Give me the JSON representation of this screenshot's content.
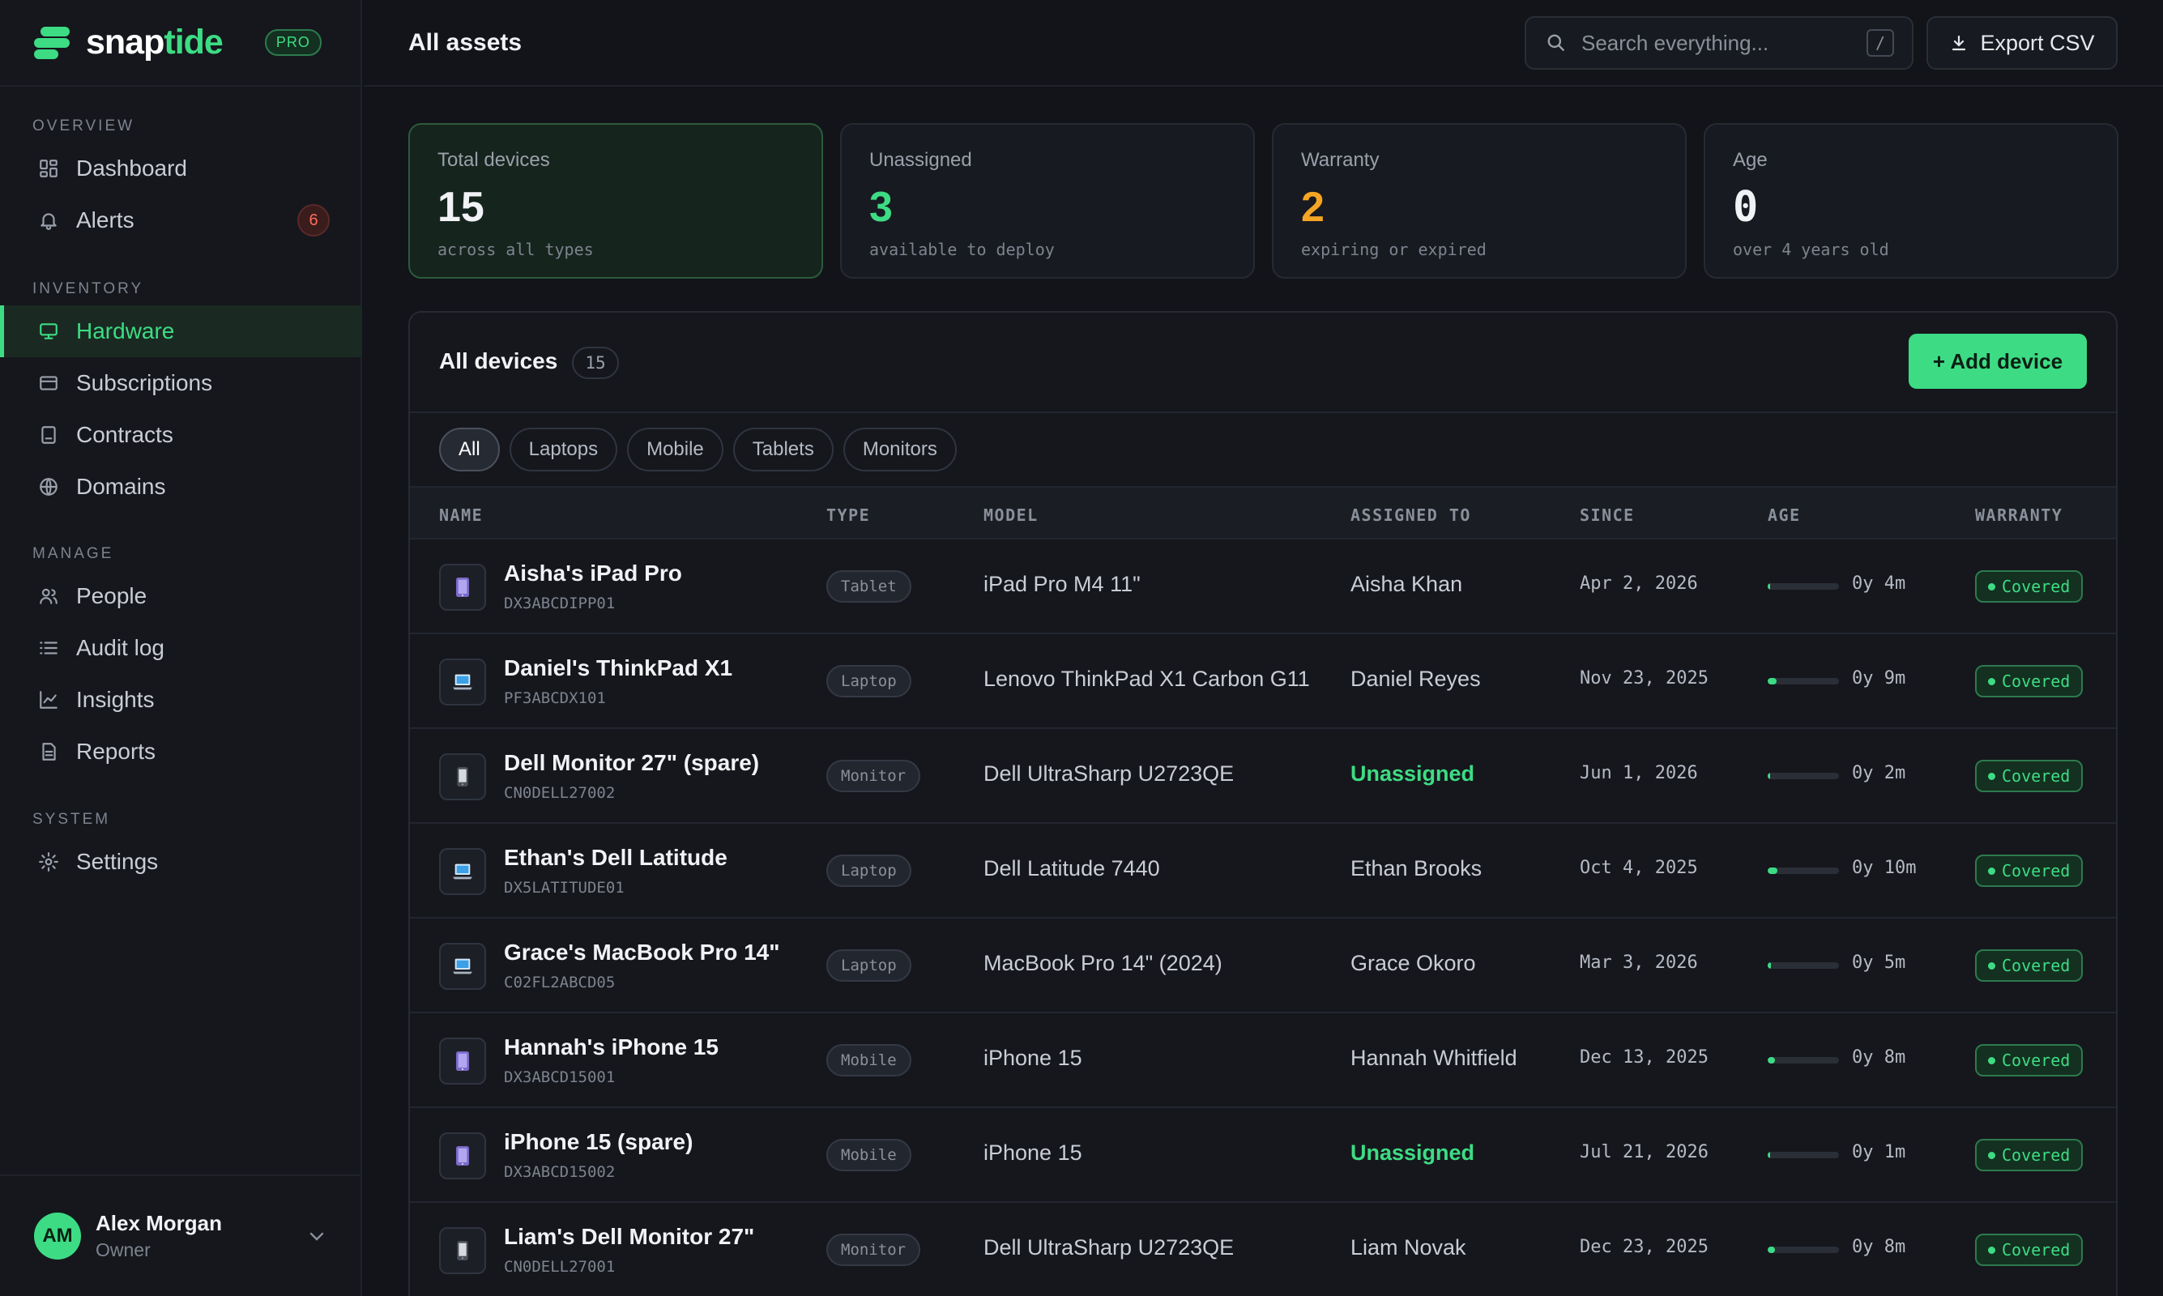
{
  "app": {
    "name_prefix": "snap",
    "name_suffix": "tide",
    "plan_badge": "PRO"
  },
  "sidebar": {
    "sections": [
      {
        "heading": "OVERVIEW",
        "items": [
          {
            "label": "Dashboard",
            "icon": "dashboard-icon"
          },
          {
            "label": "Alerts",
            "icon": "bell-icon",
            "badge": "6"
          }
        ]
      },
      {
        "heading": "INVENTORY",
        "items": [
          {
            "label": "Hardware",
            "icon": "monitor-icon",
            "active": true
          },
          {
            "label": "Subscriptions",
            "icon": "card-icon"
          },
          {
            "label": "Contracts",
            "icon": "document-icon"
          },
          {
            "label": "Domains",
            "icon": "globe-icon"
          }
        ]
      },
      {
        "heading": "MANAGE",
        "items": [
          {
            "label": "People",
            "icon": "people-icon"
          },
          {
            "label": "Audit log",
            "icon": "list-icon"
          },
          {
            "label": "Insights",
            "icon": "chart-icon"
          },
          {
            "label": "Reports",
            "icon": "report-icon"
          }
        ]
      },
      {
        "heading": "SYSTEM",
        "items": [
          {
            "label": "Settings",
            "icon": "gear-icon"
          }
        ]
      }
    ],
    "user": {
      "initials": "AM",
      "name": "Alex Morgan",
      "role": "Owner"
    }
  },
  "header": {
    "title": "All assets",
    "search_placeholder": "Search everything...",
    "search_shortcut": "/",
    "export_label": "Export CSV"
  },
  "stats": [
    {
      "label": "Total devices",
      "value": "15",
      "sub": "across all types",
      "color": "#f1f2f5"
    },
    {
      "label": "Unassigned",
      "value": "3",
      "sub": "available to deploy",
      "color": "#3ddc84"
    },
    {
      "label": "Warranty",
      "value": "2",
      "sub": "expiring or expired",
      "color": "#f5a524"
    },
    {
      "label": "Age",
      "value": "0",
      "sub": "over 4 years old",
      "color": "#f1f2f5"
    }
  ],
  "devices_panel": {
    "title": "All devices",
    "count": "15",
    "add_label": "+ Add device",
    "filters": [
      "All",
      "Laptops",
      "Mobile",
      "Tablets",
      "Monitors"
    ],
    "active_filter": "All",
    "columns": [
      "NAME",
      "TYPE",
      "MODEL",
      "ASSIGNED TO",
      "SINCE",
      "AGE",
      "WARRANTY"
    ],
    "rows": [
      {
        "name": "Aisha's iPad Pro",
        "serial": "DX3ABCDIPP01",
        "type": "Tablet",
        "icon": "tablet-icon",
        "model": "iPad Pro M4 11\"",
        "assigned": "Aisha Khan",
        "unassigned": false,
        "since": "Apr 2, 2026",
        "age_fraction": 0.03,
        "age": "0y 4m",
        "warranty": "Covered"
      },
      {
        "name": "Daniel's ThinkPad X1",
        "serial": "PF3ABCDX101",
        "type": "Laptop",
        "icon": "laptop-icon",
        "model": "Lenovo ThinkPad X1 Carbon G11",
        "assigned": "Daniel Reyes",
        "unassigned": false,
        "since": "Nov 23, 2025",
        "age_fraction": 0.12,
        "age": "0y 9m",
        "warranty": "Covered"
      },
      {
        "name": "Dell Monitor 27\" (spare)",
        "serial": "CN0DELL27002",
        "type": "Monitor",
        "icon": "monitor-device-icon",
        "model": "Dell UltraSharp U2723QE",
        "assigned": "Unassigned",
        "unassigned": true,
        "since": "Jun 1, 2026",
        "age_fraction": 0.02,
        "age": "0y 2m",
        "warranty": "Covered"
      },
      {
        "name": "Ethan's Dell Latitude",
        "serial": "DX5LATITUDE01",
        "type": "Laptop",
        "icon": "laptop-icon",
        "model": "Dell Latitude 7440",
        "assigned": "Ethan Brooks",
        "unassigned": false,
        "since": "Oct 4, 2025",
        "age_fraction": 0.14,
        "age": "0y 10m",
        "warranty": "Covered"
      },
      {
        "name": "Grace's MacBook Pro 14\"",
        "serial": "C02FL2ABCD05",
        "type": "Laptop",
        "icon": "laptop-icon",
        "model": "MacBook Pro 14\" (2024)",
        "assigned": "Grace Okoro",
        "unassigned": false,
        "since": "Mar 3, 2026",
        "age_fraction": 0.05,
        "age": "0y 5m",
        "warranty": "Covered"
      },
      {
        "name": "Hannah's iPhone 15",
        "serial": "DX3ABCD15001",
        "type": "Mobile",
        "icon": "phone-icon",
        "model": "iPhone 15",
        "assigned": "Hannah Whitfield",
        "unassigned": false,
        "since": "Dec 13, 2025",
        "age_fraction": 0.1,
        "age": "0y 8m",
        "warranty": "Covered"
      },
      {
        "name": "iPhone 15 (spare)",
        "serial": "DX3ABCD15002",
        "type": "Mobile",
        "icon": "phone-icon",
        "model": "iPhone 15",
        "assigned": "Unassigned",
        "unassigned": true,
        "since": "Jul 21, 2026",
        "age_fraction": 0.01,
        "age": "0y 1m",
        "warranty": "Covered"
      },
      {
        "name": "Liam's Dell Monitor 27\"",
        "serial": "CN0DELL27001",
        "type": "Monitor",
        "icon": "monitor-device-icon",
        "model": "Dell UltraSharp U2723QE",
        "assigned": "Liam Novak",
        "unassigned": false,
        "since": "Dec 23, 2025",
        "age_fraction": 0.1,
        "age": "0y 8m",
        "warranty": "Covered"
      }
    ]
  },
  "colors": {
    "accent": "#3ddc84",
    "warning": "#f5a524",
    "danger": "#ff6b5b",
    "background": "#121419"
  }
}
